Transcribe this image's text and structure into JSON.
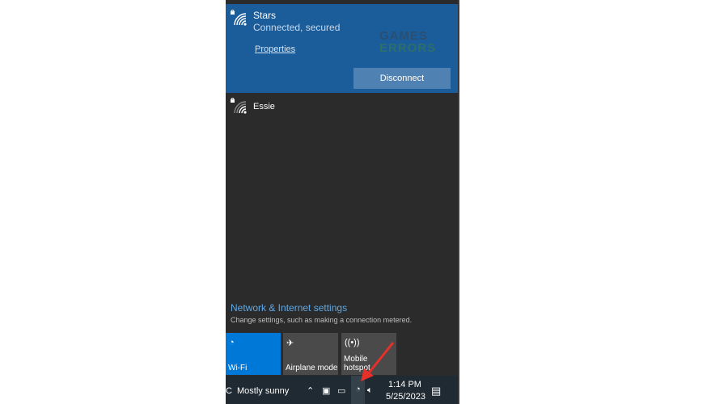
{
  "connected_network": {
    "name": "Stars",
    "status": "Connected, secured",
    "properties_label": "Properties",
    "disconnect_label": "Disconnect",
    "icon": "wifi-secured-icon"
  },
  "watermark": {
    "line1": "GAMES",
    "line2": "ERRORS"
  },
  "networks": [
    {
      "name": "Essie",
      "icon": "wifi-secured-icon"
    }
  ],
  "settings": {
    "title": "Network & Internet settings",
    "subtitle": "Change settings, such as making a connection metered."
  },
  "quick_actions": [
    {
      "label": "Wi-Fi",
      "icon": "wifi-icon",
      "active": true,
      "color": "#0078d7"
    },
    {
      "label": "Airplane mode",
      "icon": "airplane-icon",
      "active": false
    },
    {
      "label": "Mobile hotspot",
      "icon": "hotspot-icon",
      "active": false
    }
  ],
  "taskbar": {
    "weather": "Mostly sunny",
    "weather_prefix": "C",
    "time": "1:14 PM",
    "date": "5/25/2023"
  },
  "colors": {
    "accent": "#0078d7",
    "connected_bg": "#1b5d9a",
    "arrow": "#e8302a"
  }
}
